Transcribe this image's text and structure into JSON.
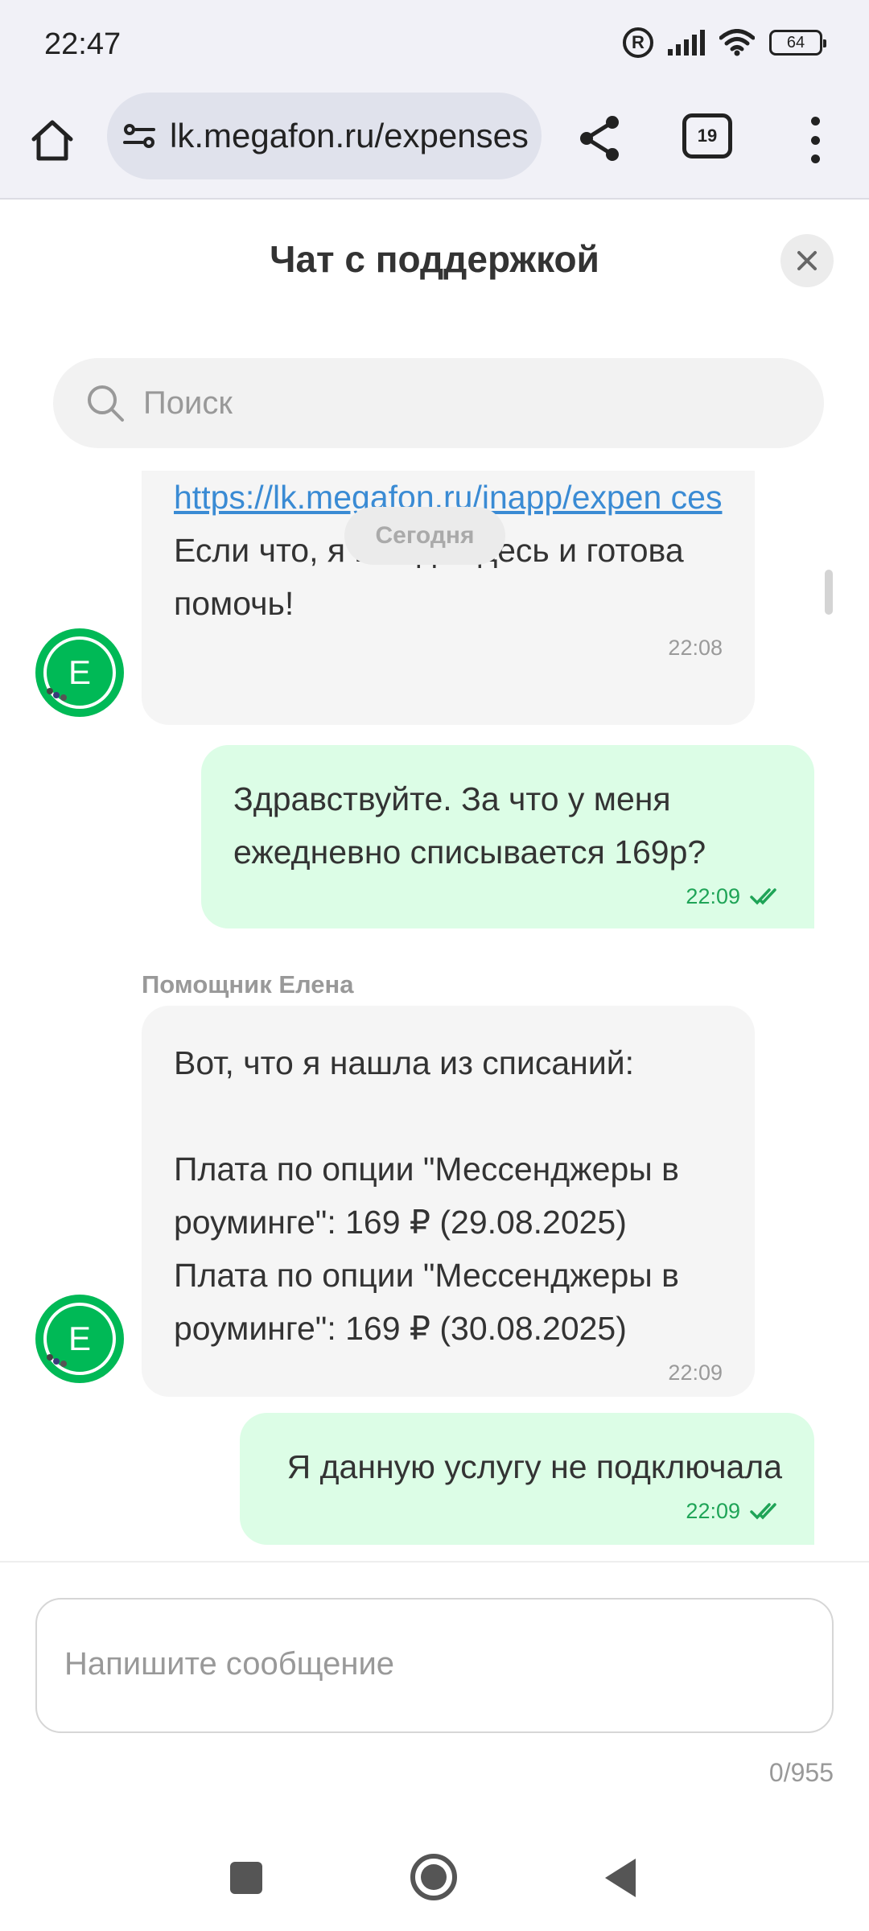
{
  "status_bar": {
    "time": "22:47",
    "roaming_badge": "R",
    "battery": "64"
  },
  "browser": {
    "url": "lk.megafon.ru/expenses",
    "tab_count": "19"
  },
  "chat": {
    "title": "Чат с поддержкой",
    "search_placeholder": "Поиск",
    "date_chip": "Сегодня",
    "messages": [
      {
        "direction": "in",
        "link": "https://lk.megafon.ru/inapp/expen ces",
        "text": "Если что, я всегда здесь и готова помочь!",
        "time": "22:08",
        "avatar_letter": "Е"
      },
      {
        "direction": "out",
        "text_line1": "Здравствуйте. За что у меня",
        "text_line2": "ежедневно списывается 169р?",
        "time": "22:09"
      },
      {
        "direction": "in",
        "sender": "Помощник Елена",
        "line1": "Вот, что я нашла из списаний:",
        "line2": "Плата по опции \"Мессенджеры в роуминге\": 169 ₽ (29.08.2025)",
        "line3": "Плата по опции \"Мессенджеры в роуминге\": 169 ₽ (30.08.2025)",
        "time": "22:09",
        "avatar_letter": "Е"
      },
      {
        "direction": "out",
        "text": "Я данную услугу не подключала",
        "time": "22:09"
      }
    ]
  },
  "composer": {
    "placeholder": "Напишите сообщение",
    "counter": "0/955"
  },
  "colors": {
    "brand_green": "#00b956",
    "outgoing_bubble": "#dcfde6",
    "incoming_bubble": "#f5f5f5",
    "link": "#3a8bd4"
  }
}
